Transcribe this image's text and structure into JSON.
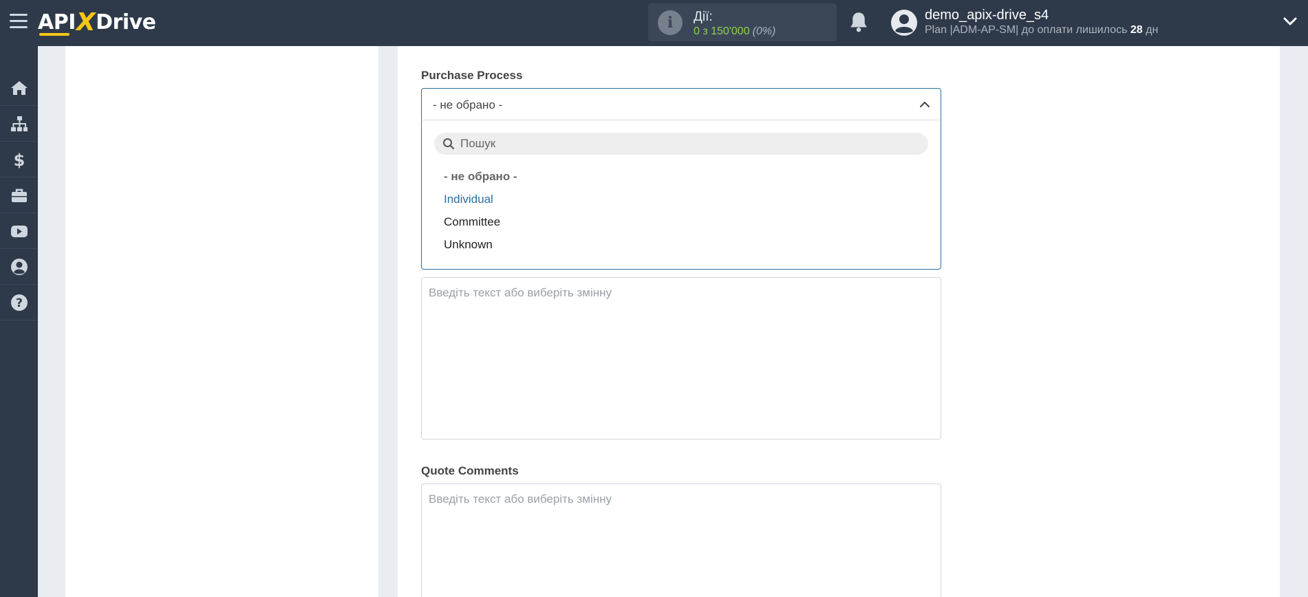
{
  "header": {
    "logo": {
      "part1": "API",
      "part2": "X",
      "part3": "Drive"
    },
    "actions": {
      "title": "Дії:",
      "count": "0 з 150'000",
      "percent": "(0%)"
    },
    "user": {
      "name": "demo_apix-drive_s4",
      "plan_prefix": "Plan |ADM-AP-SM| до оплати лишилось",
      "days": "28",
      "days_suffix": "дн"
    }
  },
  "sidebar": {
    "items": [
      {
        "icon": "home-icon"
      },
      {
        "icon": "sitemap-icon"
      },
      {
        "icon": "dollar-icon"
      },
      {
        "icon": "briefcase-icon"
      },
      {
        "icon": "youtube-icon"
      },
      {
        "icon": "user-circle-icon"
      },
      {
        "icon": "help-icon"
      }
    ]
  },
  "form": {
    "purchase_process": {
      "label": "Purchase Process",
      "selected": "- не обрано -",
      "search_placeholder": "Пошук",
      "options": [
        "- не обрано -",
        "Individual",
        "Committee",
        "Unknown"
      ]
    },
    "field_textarea_placeholder": "Введіть текст або виберіть змінну",
    "quote_comments": {
      "label": "Quote Comments",
      "placeholder": "Введіть текст або виберіть змінну"
    }
  },
  "colors": {
    "topbar": "#2e3a4a",
    "accent": "#2a6fa1",
    "logo_x": "#f5c518",
    "count_green": "#8fd14f"
  }
}
